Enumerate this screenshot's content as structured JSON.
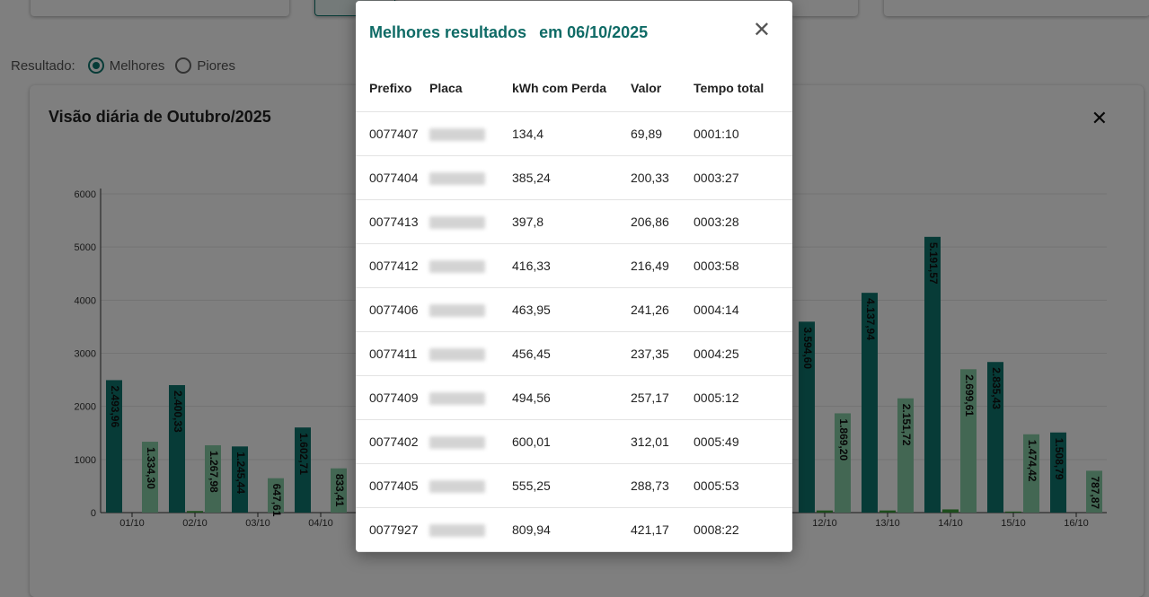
{
  "filter": {
    "label": "Resultado:",
    "options": [
      {
        "label": "Melhores",
        "selected": true
      },
      {
        "label": "Piores",
        "selected": false
      }
    ]
  },
  "chart_card": {
    "title": "Visão diária de Outubro/2025",
    "close_icon": "close-icon"
  },
  "chart_data": {
    "type": "bar",
    "ylim": [
      0,
      6000
    ],
    "yticks": [
      0,
      1000,
      2000,
      3000,
      4000,
      5000,
      6000
    ],
    "grid": true,
    "colors": {
      "series_a": "#0f766e",
      "series_b": "#86cfa6",
      "series_small": "#3a9a3a"
    },
    "categories": [
      "01/10",
      "02/10",
      "03/10",
      "04/10",
      "12/10",
      "13/10",
      "14/10",
      "15/10",
      "16/10"
    ],
    "series": [
      {
        "values": [
          2493.96,
          2400.33,
          1245.44,
          1602.71,
          3594.6,
          4137.94,
          5191.57,
          2835.43,
          1508.79
        ],
        "labels": [
          "2.493,96",
          "2.400,33",
          "1.245,44",
          "1.602,71",
          "3.594,60",
          "4.137,94",
          "5.191,57",
          "2.835,43",
          "1.508,79"
        ]
      },
      {
        "values": [
          0,
          30,
          0,
          0,
          40,
          40,
          60,
          20,
          0
        ]
      },
      {
        "values": [
          1334.3,
          1267.98,
          647.61,
          833.41,
          1869.2,
          2151.72,
          2699.61,
          1474.42,
          787.87
        ],
        "labels": [
          "1.334,30",
          "1.267,98",
          "647,61",
          "833,41",
          "1.869,20",
          "2.151,72",
          "2.699,61",
          "1.474,42",
          "787,87"
        ]
      }
    ]
  },
  "modal": {
    "title": "Melhores resultados",
    "date": "em 06/10/2025",
    "close_icon": "close-icon",
    "columns": [
      "Prefixo",
      "Placa",
      "kWh com Perda",
      "Valor",
      "Tempo total"
    ],
    "rows": [
      {
        "prefixo": "0077407",
        "kwh": "134,4",
        "valor": "69,89",
        "tempo": "0001:10"
      },
      {
        "prefixo": "0077404",
        "kwh": "385,24",
        "valor": "200,33",
        "tempo": "0003:27"
      },
      {
        "prefixo": "0077413",
        "kwh": "397,8",
        "valor": "206,86",
        "tempo": "0003:28"
      },
      {
        "prefixo": "0077412",
        "kwh": "416,33",
        "valor": "216,49",
        "tempo": "0003:58"
      },
      {
        "prefixo": "0077406",
        "kwh": "463,95",
        "valor": "241,26",
        "tempo": "0004:14"
      },
      {
        "prefixo": "0077411",
        "kwh": "456,45",
        "valor": "237,35",
        "tempo": "0004:25"
      },
      {
        "prefixo": "0077409",
        "kwh": "494,56",
        "valor": "257,17",
        "tempo": "0005:12"
      },
      {
        "prefixo": "0077402",
        "kwh": "600,01",
        "valor": "312,01",
        "tempo": "0005:49"
      },
      {
        "prefixo": "0077405",
        "kwh": "555,25",
        "valor": "288,73",
        "tempo": "0005:53"
      },
      {
        "prefixo": "0077927",
        "kwh": "809,94",
        "valor": "421,17",
        "tempo": "0008:22"
      }
    ]
  }
}
